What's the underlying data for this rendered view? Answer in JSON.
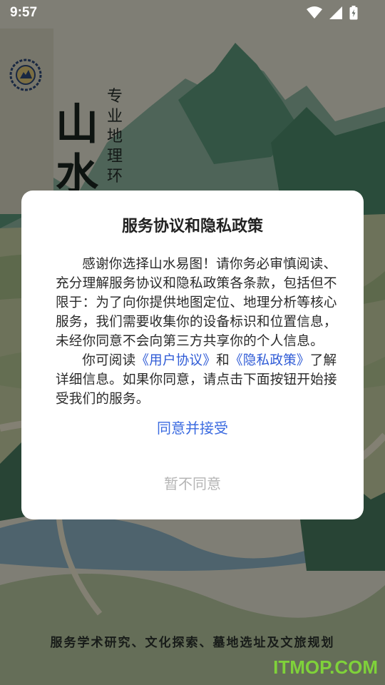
{
  "status_bar": {
    "time": "9:57",
    "icons": [
      "wifi-icon",
      "signal-icon",
      "battery-charging-icon"
    ]
  },
  "splash": {
    "title_chars": [
      "山",
      "水"
    ],
    "subtitle_chars": [
      "专",
      "业",
      "地",
      "理",
      "环"
    ],
    "footer_slogan": "服务学术研究、文化探索、墓地选址及文旅规划",
    "watermark": "ITMOP.COM"
  },
  "dialog": {
    "title": "服务协议和隐私政策",
    "paragraph1": "感谢你选择山水易图！请你务必审慎阅读、充分理解服务协议和隐私政策各条款，包括但不限于：为了向你提供地图定位、地理分析等核心服务，我们需要收集你的设备标识和位置信息，未经你同意不会向第三方共享你的个人信息。",
    "paragraph2_prefix": "你可阅读",
    "user_agreement_link": "《用户协议》",
    "paragraph2_and": "和",
    "privacy_policy_link": "《隐私政策》",
    "paragraph2_suffix": "了解详细信息。如果你同意，请点击下面按钮开始接受我们的服务。",
    "accept_button": "同意并接受",
    "decline_button": "暂不同意"
  },
  "colors": {
    "link": "#2f5bd6",
    "accept": "#3b6be0",
    "decline": "#b5b5b5",
    "watermark": "#7fd23a"
  }
}
